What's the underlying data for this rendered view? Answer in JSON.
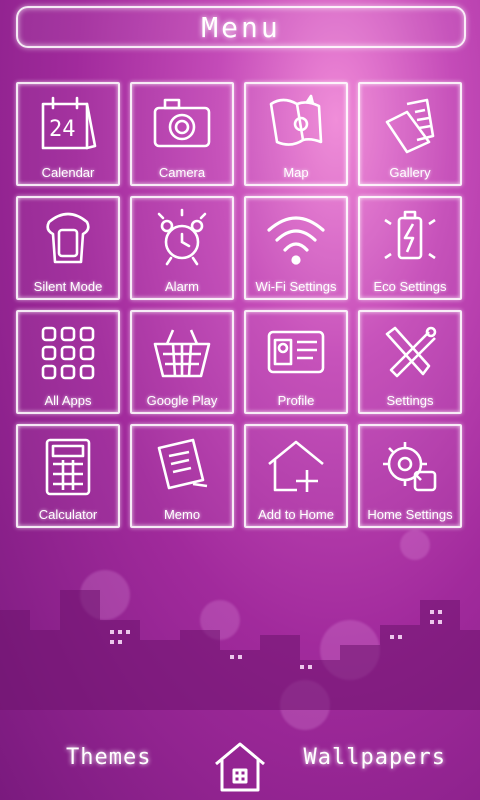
{
  "header": {
    "title": "Menu"
  },
  "grid": [
    {
      "label": "Calendar",
      "icon": "calendar-icon"
    },
    {
      "label": "Camera",
      "icon": "camera-icon"
    },
    {
      "label": "Map",
      "icon": "map-icon"
    },
    {
      "label": "Gallery",
      "icon": "gallery-icon"
    },
    {
      "label": "Silent Mode",
      "icon": "silent-mode-icon"
    },
    {
      "label": "Alarm",
      "icon": "alarm-icon"
    },
    {
      "label": "Wi-Fi Settings",
      "icon": "wifi-icon"
    },
    {
      "label": "Eco Settings",
      "icon": "eco-battery-icon"
    },
    {
      "label": "All Apps",
      "icon": "all-apps-icon"
    },
    {
      "label": "Google Play",
      "icon": "shopping-basket-icon"
    },
    {
      "label": "Profile",
      "icon": "profile-card-icon"
    },
    {
      "label": "Settings",
      "icon": "tools-icon"
    },
    {
      "label": "Calculator",
      "icon": "calculator-icon"
    },
    {
      "label": "Memo",
      "icon": "memo-icon"
    },
    {
      "label": "Add to Home",
      "icon": "add-home-icon"
    },
    {
      "label": "Home Settings",
      "icon": "home-settings-icon"
    }
  ],
  "calendar_day": "24",
  "bottom": {
    "themes": "Themes",
    "wallpapers": "Wallpapers",
    "home_icon": "home-icon"
  },
  "colors": {
    "accent": "#ffffff",
    "bg_top": "#f08ad8",
    "bg_bottom": "#7a1a7e"
  }
}
